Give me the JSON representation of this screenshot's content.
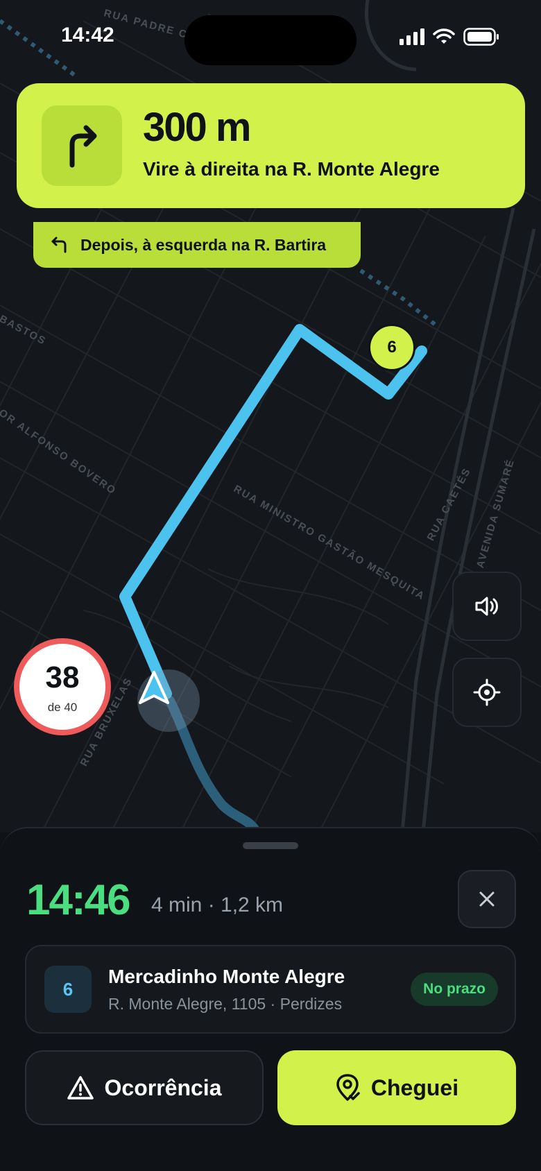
{
  "status_bar": {
    "time": "14:42"
  },
  "map": {
    "street_labels": {
      "padre_chico": "RUA PADRE CHICO",
      "bastos": "BASTOS",
      "alfonso_bovero": "OR ALFONSO BOVERO",
      "ministro": "RUA MINISTRO GASTÃO MESQUITA",
      "caetes": "RUA CAETÉS",
      "sumare": "AVENIDA SUMARÉ",
      "bruxelas": "RUA BRUXELAS"
    },
    "stop_marker": "6"
  },
  "navigation": {
    "distance": "300 m",
    "instruction": "Vire à direita na R. Monte Alegre",
    "next_instruction": "Depois, à esquerda na R. Bartira",
    "turn_icon": "turn-right-icon",
    "next_turn_icon": "turn-left-icon"
  },
  "speed": {
    "current": "38",
    "limit": "de 40"
  },
  "sheet": {
    "eta": "14:46",
    "meta": "4 min · 1,2 km",
    "stop": {
      "number": "6",
      "name": "Mercadinho Monte Alegre",
      "address": "R. Monte Alegre, 1105 · Perdizes",
      "status": "No prazo"
    },
    "buttons": {
      "occurrence": "Ocorrência",
      "arrived": "Cheguei"
    }
  },
  "colors": {
    "accent": "#d2f14a",
    "route": "#4cc3ef",
    "eta": "#4ade80",
    "speed_ring": "#ef5b5b"
  }
}
